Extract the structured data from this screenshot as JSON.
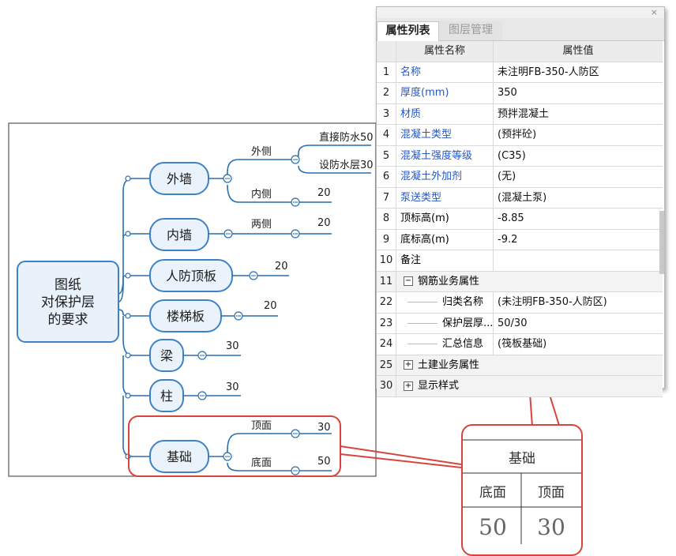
{
  "mindmap": {
    "root": "图纸\n对保护层\n的要求",
    "nodes": {
      "outer_wall": "外墙",
      "inner_wall": "内墙",
      "civil_roof": "人防顶板",
      "stair": "楼梯板",
      "beam": "梁",
      "column": "柱",
      "foundation": "基础"
    },
    "labels": {
      "outer_side": "外侧",
      "inner_side": "内侧",
      "both_sides": "两侧",
      "direct_waterproof": "直接防水50",
      "waterproof_layer": "设防水层30",
      "top_face": "顶面",
      "bottom_face": "底面"
    },
    "values": {
      "outer_inner": "20",
      "inner_both": "20",
      "roof": "20",
      "stair": "20",
      "beam": "30",
      "column": "30",
      "foundation_top": "30",
      "foundation_bottom": "50"
    }
  },
  "panel": {
    "tabs": [
      "属性列表",
      "图层管理"
    ],
    "close": "×",
    "header": {
      "name": "属性名称",
      "value": "属性值"
    },
    "rows": [
      {
        "idx": "1",
        "name": "名称",
        "value": "未注明FB-350-人防区",
        "blue": true
      },
      {
        "idx": "2",
        "name": "厚度(mm)",
        "value": "350",
        "blue": true
      },
      {
        "idx": "3",
        "name": "材质",
        "value": "预拌混凝土",
        "blue": true
      },
      {
        "idx": "4",
        "name": "混凝土类型",
        "value": "(预拌砼)",
        "blue": true
      },
      {
        "idx": "5",
        "name": "混凝土强度等级",
        "value": "(C35)",
        "blue": true
      },
      {
        "idx": "6",
        "name": "混凝土外加剂",
        "value": "(无)",
        "blue": true
      },
      {
        "idx": "7",
        "name": "泵送类型",
        "value": "(混凝土泵)",
        "blue": true
      },
      {
        "idx": "8",
        "name": "顶标高(m)",
        "value": "-8.85",
        "blue": false
      },
      {
        "idx": "9",
        "name": "底标高(m)",
        "value": "-9.2",
        "blue": false
      },
      {
        "idx": "10",
        "name": "备注",
        "value": "",
        "blue": false
      }
    ],
    "group_rebar": {
      "idx": "11",
      "sign": "−",
      "label": "钢筋业务属性"
    },
    "sub_rows": [
      {
        "idx": "22",
        "name": "归类名称",
        "value": "(未注明FB-350-人防区)"
      },
      {
        "idx": "23",
        "name": "保护层厚...",
        "value": "50/30"
      },
      {
        "idx": "24",
        "name": "汇总信息",
        "value": "(筏板基础)"
      }
    ],
    "group_civil": {
      "idx": "25",
      "sign": "+",
      "label": "土建业务属性"
    },
    "group_display": {
      "idx": "30",
      "sign": "+",
      "label": "显示样式"
    }
  },
  "inset": {
    "title": "基础",
    "col1": "底面",
    "col2": "顶面",
    "val1": "50",
    "val2": "30"
  },
  "colors": {
    "highlight": "#d8453c",
    "line": "#2a6fb0",
    "node_border": "#3f82c4",
    "node_fill": "#eaf3fc"
  }
}
